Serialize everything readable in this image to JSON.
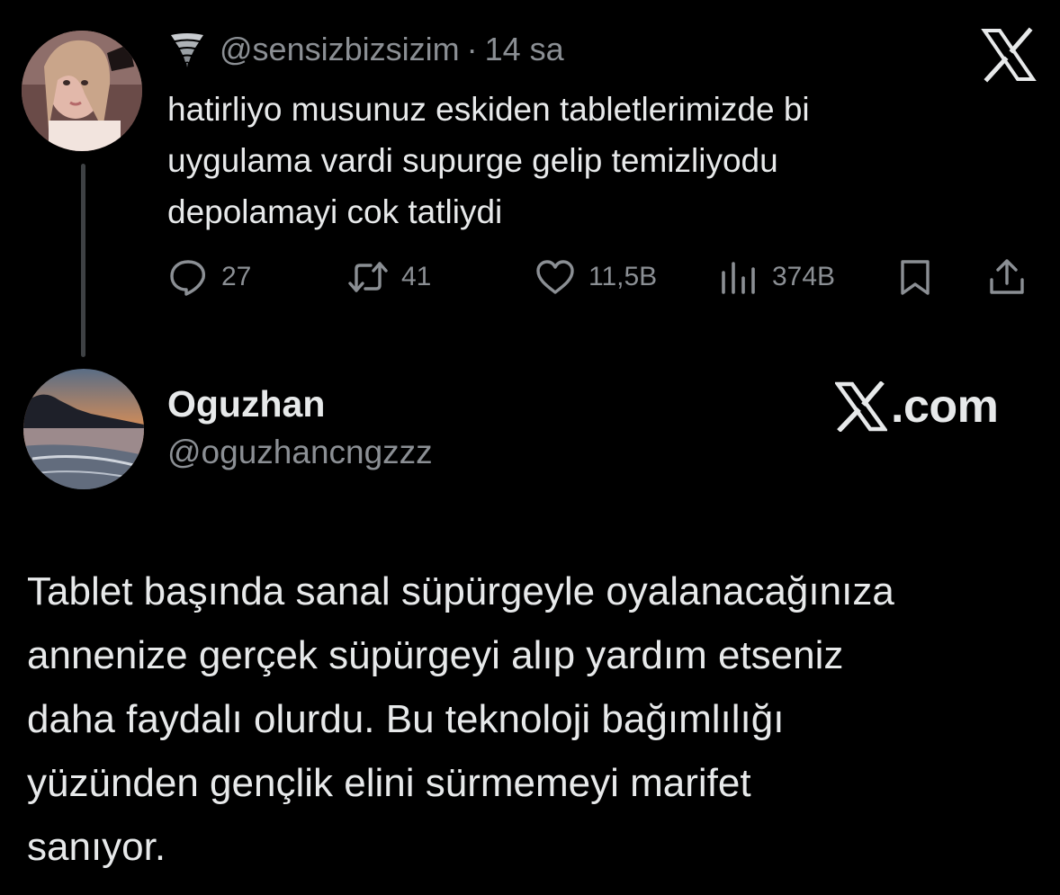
{
  "quoted_tweet": {
    "handle": "@sensizbizsizim",
    "separator": "·",
    "time": "14 sa",
    "avatar_icon": "profile-photo-woman",
    "handle_badge_icon": "tornado-icon",
    "lines": [
      "hatirliyo musunuz eskiden tabletlerimizde bi",
      "uygulama vardi supurge gelip temizliyodu",
      "depolamayi cok tatliydi"
    ],
    "actions": {
      "replies": "27",
      "reposts": "41",
      "likes": "11,5B",
      "views": "374B"
    }
  },
  "reply": {
    "name": "Oguzhan",
    "handle": "@oguzhancngzzz",
    "avatar_icon": "profile-photo-beach-sunset",
    "brand": ".com",
    "brand_icon": "x-logo-icon",
    "lines": [
      "Tablet başında sanal süpürgeyle oyalanacağınıza",
      "annenize gerçek süpürgeyi alıp yardım etseniz",
      "daha faydalı olurdu. Bu teknoloji bağımlılığı",
      "yüzünden gençlik elini sürmemeyi marifet",
      "sanıyor."
    ]
  },
  "colors": {
    "background": "#000000",
    "primary_text": "#e7e9ea",
    "secondary_text": "#8b8f94",
    "thread_line": "#3e4144"
  }
}
